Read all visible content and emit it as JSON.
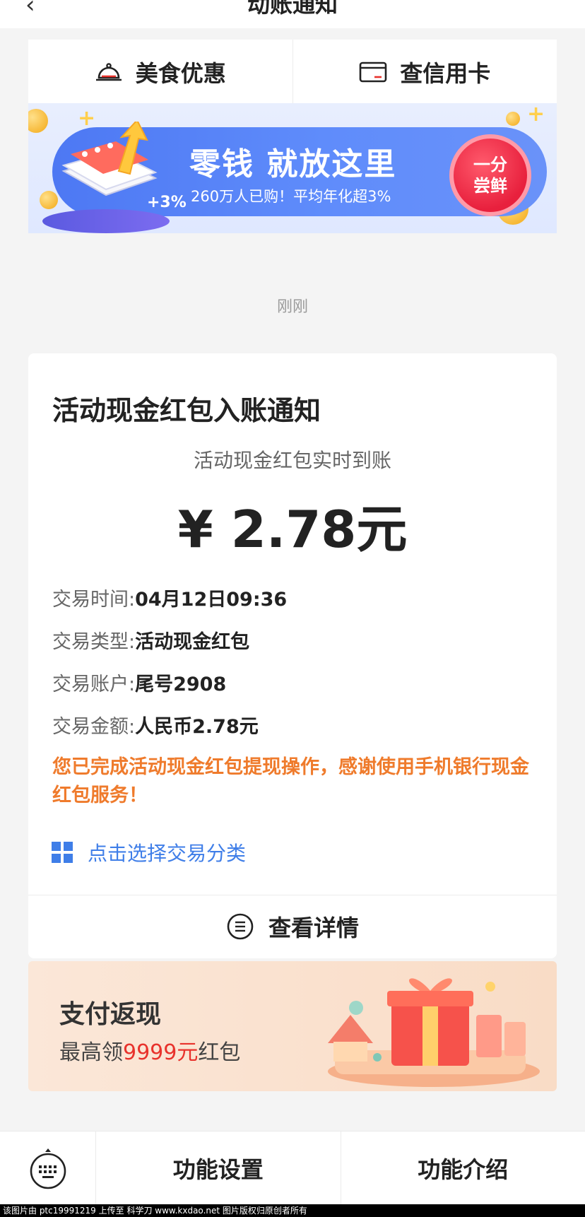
{
  "header": {
    "back_icon": "chevron-left-icon",
    "title": "动账通知",
    "more_icon": "more-dots-icon",
    "more_text": "···"
  },
  "quick_links": [
    {
      "label": "美食优惠",
      "icon": "dining-cloche-icon"
    },
    {
      "label": "查信用卡",
      "icon": "credit-card-icon"
    }
  ],
  "banner": {
    "title": "零钱 就放这里",
    "subtitle": "260万人已购！平均年化超3%",
    "badge_line1": "一分",
    "badge_line2": "尝鲜",
    "percent_tag": "+3%"
  },
  "timestamp": "刚刚",
  "notification": {
    "title": "活动现金红包入账通知",
    "subtitle": "活动现金红包实时到账",
    "amount": "¥ 2.78元",
    "details": [
      {
        "label": "交易时间:",
        "value": "04月12日09:36"
      },
      {
        "label": "交易类型:",
        "value": "活动现金红包"
      },
      {
        "label": "交易账户:",
        "value": "尾号2908"
      },
      {
        "label": "交易金额:",
        "value": "人民币2.78元"
      }
    ],
    "notice": "您已完成活动现金红包提现操作，感谢使用手机银行现金红包服务！",
    "category_link": "点击选择交易分类",
    "view_detail": "查看详情"
  },
  "promo": {
    "title": "支付返现",
    "sub_prefix": "最高领",
    "sub_highlight": "9999元",
    "sub_suffix": "红包"
  },
  "bottom_bar": {
    "keyboard_icon": "keyboard-icon",
    "actions": [
      "功能设置",
      "功能介绍"
    ]
  },
  "watermark": "该图片由 ptc19991219 上传至 科学刀 www.kxdao.net 图片版权归原创者所有",
  "colors": {
    "accent_blue": "#3f7ee8",
    "notice_orange": "#ef7b2c",
    "promo_red": "#e8322c",
    "background": "#f4f4f4"
  }
}
